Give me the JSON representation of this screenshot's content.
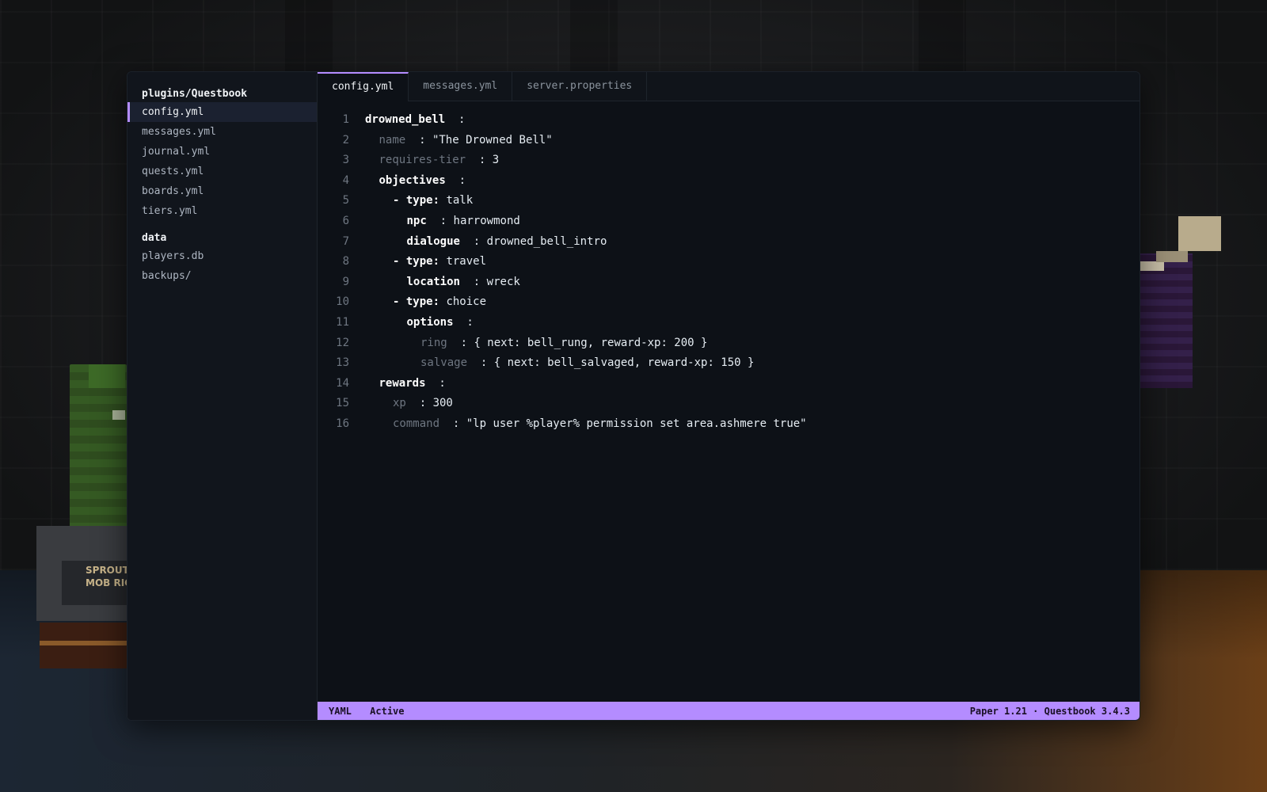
{
  "background": {
    "sign_line_1": "SPROUT",
    "sign_line_2": "MOB RIG"
  },
  "sidebar": {
    "sections": [
      {
        "title": "plugins/Questbook",
        "items": [
          {
            "label": "config.yml",
            "active": true
          },
          {
            "label": "messages.yml",
            "active": false
          },
          {
            "label": "journal.yml",
            "active": false
          },
          {
            "label": "quests.yml",
            "active": false
          },
          {
            "label": "boards.yml",
            "active": false
          },
          {
            "label": "tiers.yml",
            "active": false
          }
        ]
      },
      {
        "title": "data",
        "items": [
          {
            "label": "players.db",
            "active": false
          },
          {
            "label": "backups/",
            "active": false
          }
        ]
      }
    ]
  },
  "tabs": [
    {
      "label": "config.yml",
      "active": true
    },
    {
      "label": "messages.yml",
      "active": false
    },
    {
      "label": "server.properties",
      "active": false
    }
  ],
  "editor": {
    "lines": [
      {
        "n": "1",
        "key": "drowned_bell",
        "sep": "  :",
        "value": "",
        "indent": 0,
        "style": "k"
      },
      {
        "n": "2",
        "key": "name",
        "sep": "  : ",
        "value": "\"The Drowned Bell\"",
        "indent": 1,
        "style": "kd"
      },
      {
        "n": "3",
        "key": "requires-tier",
        "sep": "  : ",
        "value": "3",
        "indent": 1,
        "style": "kd"
      },
      {
        "n": "4",
        "key": "objectives",
        "sep": "  :",
        "value": "",
        "indent": 1,
        "style": "k"
      },
      {
        "n": "5",
        "key": "- type:",
        "sep": " ",
        "value": "talk",
        "indent": 2,
        "style": "k"
      },
      {
        "n": "6",
        "key": "npc",
        "sep": "  : ",
        "value": "harrowmond",
        "indent": 3,
        "style": "k"
      },
      {
        "n": "7",
        "key": "dialogue",
        "sep": "  : ",
        "value": "drowned_bell_intro",
        "indent": 3,
        "style": "k"
      },
      {
        "n": "8",
        "key": "- type:",
        "sep": " ",
        "value": "travel",
        "indent": 2,
        "style": "k"
      },
      {
        "n": "9",
        "key": "location",
        "sep": "  : ",
        "value": "wreck",
        "indent": 3,
        "style": "k"
      },
      {
        "n": "10",
        "key": "- type:",
        "sep": " ",
        "value": "choice",
        "indent": 2,
        "style": "k"
      },
      {
        "n": "11",
        "key": "options",
        "sep": "  :",
        "value": "",
        "indent": 3,
        "style": "k"
      },
      {
        "n": "12",
        "key": "ring",
        "sep": "  : ",
        "value": "{ next: bell_rung, reward-xp: 200 }",
        "indent": 4,
        "style": "kd"
      },
      {
        "n": "13",
        "key": "salvage",
        "sep": "  : ",
        "value": "{ next: bell_salvaged, reward-xp: 150 }",
        "indent": 4,
        "style": "kd"
      },
      {
        "n": "14",
        "key": "rewards",
        "sep": "  :",
        "value": "",
        "indent": 1,
        "style": "k"
      },
      {
        "n": "15",
        "key": "xp",
        "sep": "  : ",
        "value": "300",
        "indent": 2,
        "style": "kd"
      },
      {
        "n": "16",
        "key": "command",
        "sep": "  : ",
        "value": "\"lp user %player% permission set area.ashmere true\"",
        "indent": 2,
        "style": "kd"
      }
    ]
  },
  "statusbar": {
    "language": "YAML",
    "state": "Active",
    "version": "Paper 1.21 · Questbook 3.4.3"
  },
  "colors": {
    "accent": "#b48cff",
    "editor_bg": "#0d1117",
    "sidebar_bg": "#11151c"
  }
}
